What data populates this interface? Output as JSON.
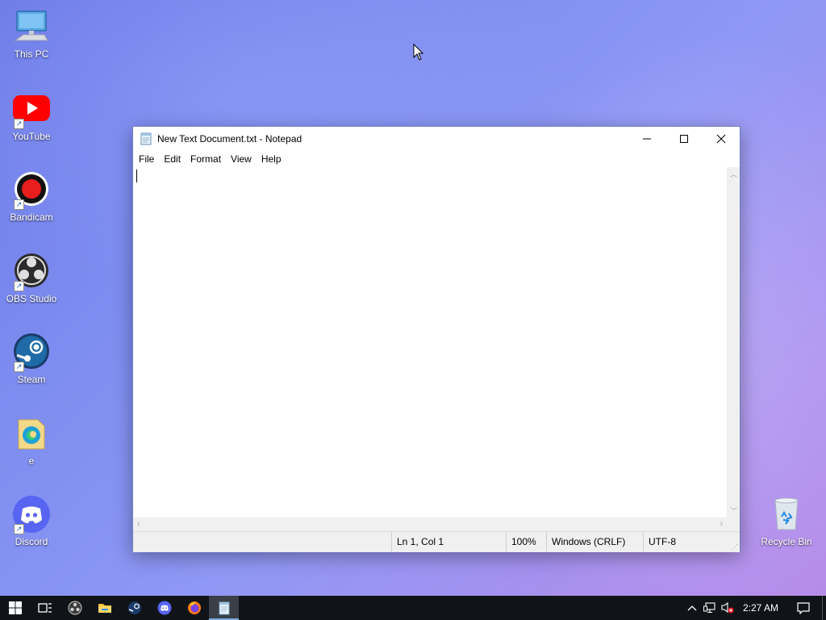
{
  "desktop": {
    "icons": [
      {
        "label": "This PC"
      },
      {
        "label": "YouTube"
      },
      {
        "label": "Bandicam"
      },
      {
        "label": "OBS Studio"
      },
      {
        "label": "Steam"
      },
      {
        "label": "e"
      },
      {
        "label": "Discord"
      },
      {
        "label": "Recycle Bin"
      }
    ]
  },
  "window": {
    "title": "New Text Document.txt - Notepad",
    "menu": [
      "File",
      "Edit",
      "Format",
      "View",
      "Help"
    ],
    "content": "",
    "status": {
      "position": "Ln 1, Col 1",
      "zoom": "100%",
      "line_endings": "Windows (CRLF)",
      "encoding": "UTF-8"
    }
  },
  "taskbar": {
    "clock": "2:27 AM",
    "apps": [
      "start-icon",
      "task-view-icon",
      "obs-icon",
      "file-explorer-icon",
      "steam-icon",
      "discord-icon",
      "firefox-icon",
      "notepad-icon"
    ]
  },
  "colors": {
    "accent": "#7aa9e0",
    "youtube": "#ff0000",
    "discord": "#5865f2",
    "taskbar": "#101418"
  }
}
